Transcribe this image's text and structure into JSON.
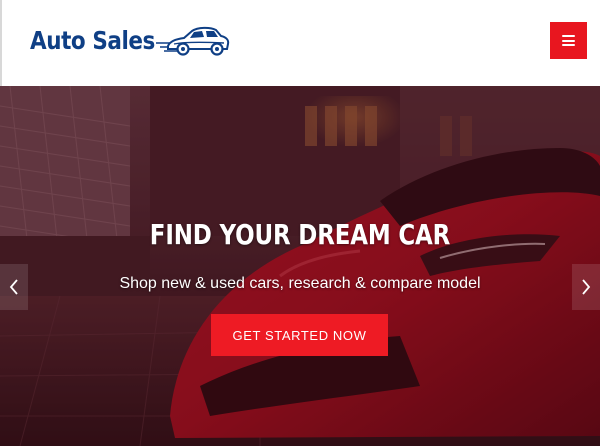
{
  "brand": {
    "name": "Auto Sales",
    "logo_icon": "car-silhouette-icon",
    "colors": {
      "logo_blue": "#0f3f85",
      "accent_red": "#e8161f"
    }
  },
  "header": {
    "menu_icon": "hamburger-menu-icon"
  },
  "hero": {
    "title": "FIND YOUR DREAM CAR",
    "subtitle": "Shop new & used cars, research & compare model",
    "cta_label": "GET STARTED NOW",
    "prev_icon": "chevron-left-icon",
    "next_icon": "chevron-right-icon"
  }
}
